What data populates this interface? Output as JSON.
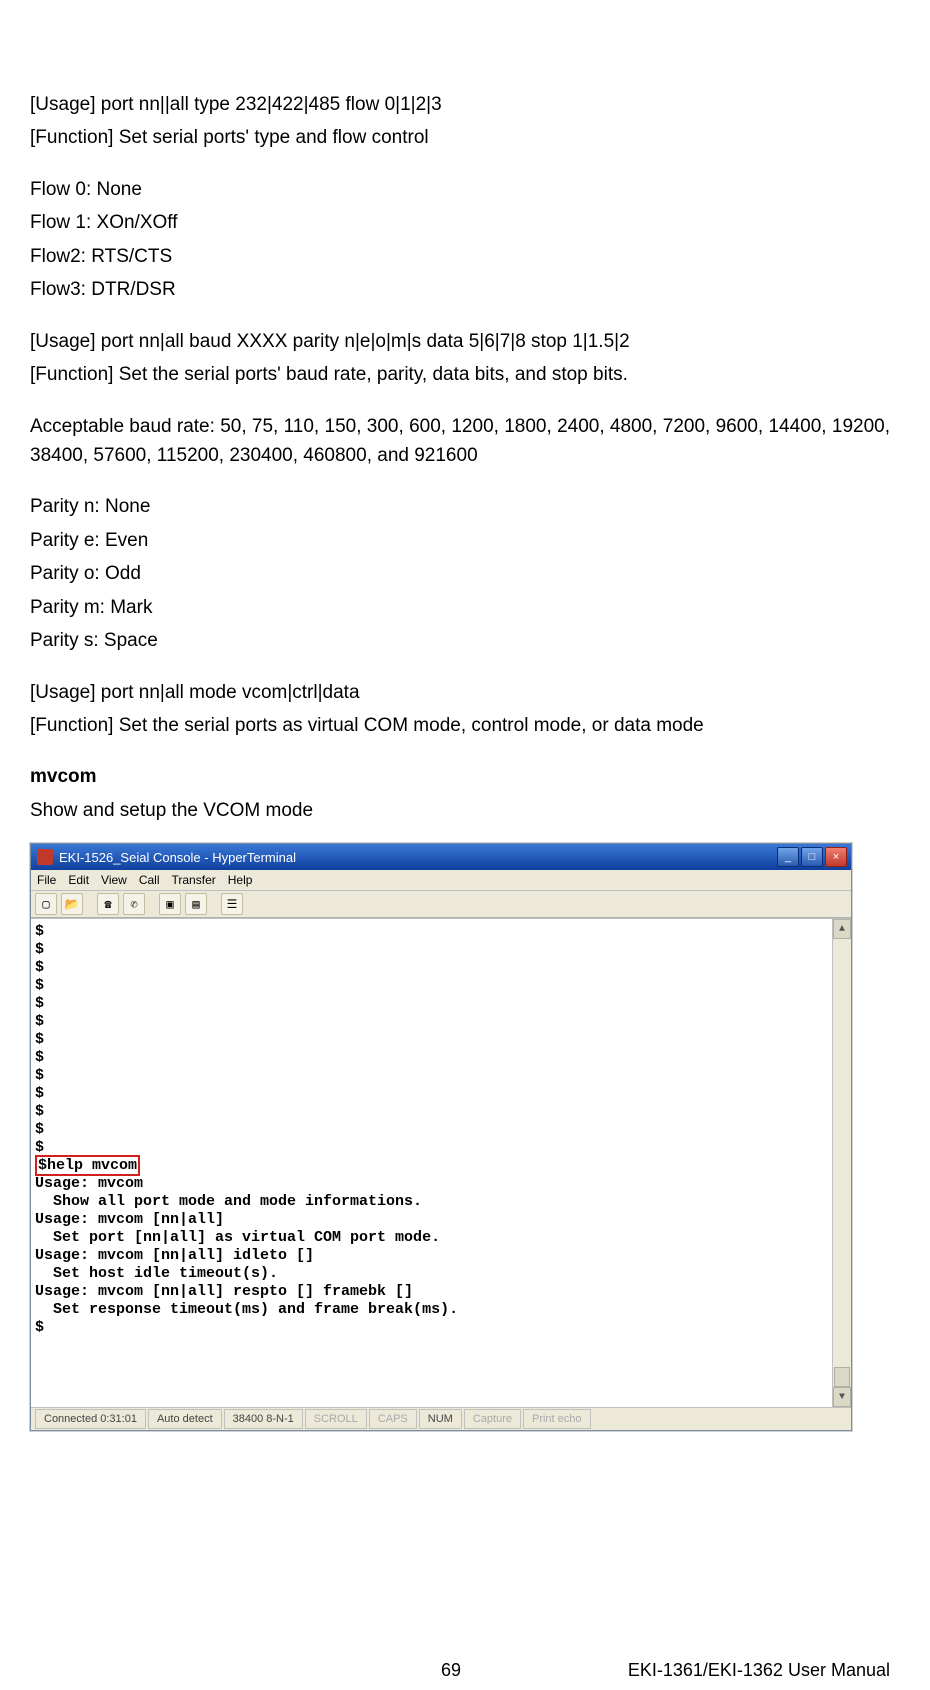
{
  "body": {
    "p1": "[Usage] port nn||all type 232|422|485 flow 0|1|2|3",
    "p2": "[Function] Set serial ports' type and flow control",
    "p3": "Flow 0: None",
    "p4": "Flow 1: XOn/XOff",
    "p5": "Flow2: RTS/CTS",
    "p6": "Flow3: DTR/DSR",
    "p7": "[Usage] port nn|all baud XXXX parity n|e|o|m|s data 5|6|7|8 stop 1|1.5|2",
    "p8": "[Function] Set the serial ports' baud rate, parity, data bits, and stop bits.",
    "p9": "Acceptable baud rate: 50, 75, 110, 150, 300, 600, 1200, 1800, 2400, 4800, 7200, 9600, 14400, 19200, 38400, 57600, 115200, 230400, 460800, and 921600",
    "p10": "Parity n: None",
    "p11": "Parity e: Even",
    "p12": "Parity o: Odd",
    "p13": "Parity m: Mark",
    "p14": "Parity s: Space",
    "p15": "[Usage] port nn|all mode vcom|ctrl|data",
    "p16": "[Function] Set the serial ports as virtual COM mode, control mode, or data mode",
    "cmd_heading": "mvcom",
    "cmd_desc": "Show and setup the VCOM mode"
  },
  "terminal": {
    "title": "EKI-1526_Seial Console - HyperTerminal",
    "menus": [
      "File",
      "Edit",
      "View",
      "Call",
      "Transfer",
      "Help"
    ],
    "prompts": "$\n$\n$\n$\n$\n$\n$\n$\n$\n$\n$\n$\n$",
    "highlight_line": "$help mvcom",
    "help_output": "Usage: mvcom\n  Show all port mode and mode informations.\nUsage: mvcom [nn|all]\n  Set port [nn|all] as virtual COM port mode.\nUsage: mvcom [nn|all] idleto []\n  Set host idle timeout(s).\nUsage: mvcom [nn|all] respto [] framebk []\n  Set response timeout(ms) and frame break(ms).\n$",
    "status": {
      "conn": "Connected 0:31:01",
      "detect": "Auto detect",
      "settings": "38400 8-N-1",
      "scroll": "SCROLL",
      "caps": "CAPS",
      "num": "NUM",
      "capture": "Capture",
      "printecho": "Print echo"
    }
  },
  "footer": {
    "page": "69",
    "doc": "EKI-1361/EKI-1362 User Manual"
  }
}
